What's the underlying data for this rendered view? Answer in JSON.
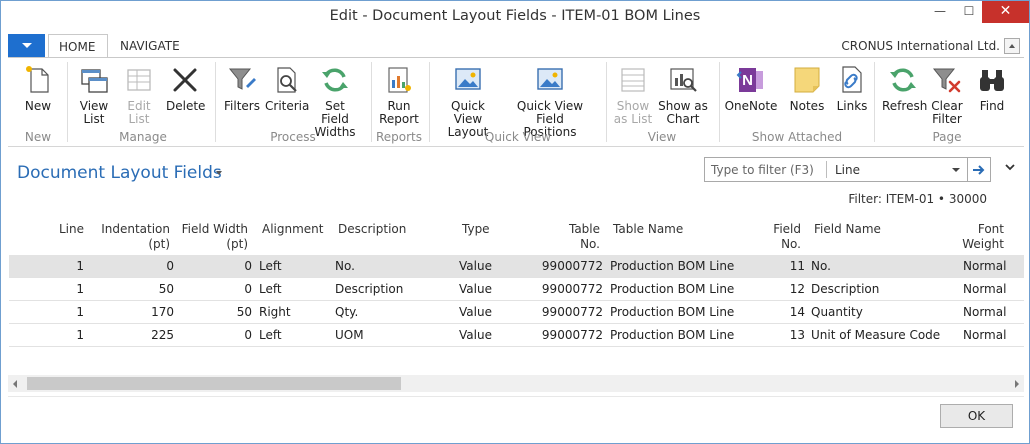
{
  "window": {
    "title": "Edit - Document Layout Fields - ITEM-01 BOM Lines",
    "minimize": "—",
    "maximize": "☐",
    "close": "✕"
  },
  "tabs": [
    {
      "label": "HOME",
      "active": true
    },
    {
      "label": "NAVIGATE",
      "active": false
    }
  ],
  "company": "CRONUS International Ltd.",
  "ribbon": {
    "groups": [
      {
        "label": "New"
      },
      {
        "label": "Manage"
      },
      {
        "label": "Process"
      },
      {
        "label": "Reports"
      },
      {
        "label": "Quick View"
      },
      {
        "label": "View"
      },
      {
        "label": "Show Attached"
      },
      {
        "label": "Page"
      }
    ],
    "buttons": {
      "new": {
        "l1": "New",
        "l2": "",
        "icon": "new-doc-icon"
      },
      "view_list": {
        "l1": "View",
        "l2": "List",
        "icon": "view-list-icon"
      },
      "edit_list": {
        "l1": "Edit",
        "l2": "List",
        "icon": "edit-list-icon"
      },
      "delete": {
        "l1": "Delete",
        "l2": "",
        "icon": "delete-icon"
      },
      "filters": {
        "l1": "Filters",
        "l2": "",
        "icon": "filter-icon"
      },
      "criteria": {
        "l1": "Criteria",
        "l2": "",
        "icon": "criteria-icon"
      },
      "set_field_widths": {
        "l1": "Set Field",
        "l2": "Widths",
        "icon": "refresh-icon"
      },
      "run_report": {
        "l1": "Run",
        "l2": "Report",
        "icon": "report-icon"
      },
      "qv_layout": {
        "l1": "Quick View",
        "l2": "Layout",
        "icon": "picture-icon"
      },
      "qv_field_positions": {
        "l1": "Quick View Field",
        "l2": "Positions",
        "icon": "picture-icon"
      },
      "show_as_list": {
        "l1": "Show",
        "l2": "as List",
        "icon": "list-icon"
      },
      "show_as_chart": {
        "l1": "Show as",
        "l2": "Chart",
        "icon": "chart-icon"
      },
      "onenote": {
        "l1": "OneNote",
        "l2": "",
        "icon": "onenote-icon"
      },
      "notes": {
        "l1": "Notes",
        "l2": "",
        "icon": "note-icon"
      },
      "links": {
        "l1": "Links",
        "l2": "",
        "icon": "link-icon"
      },
      "refresh": {
        "l1": "Refresh",
        "l2": "",
        "icon": "refresh-icon"
      },
      "clear_filter": {
        "l1": "Clear",
        "l2": "Filter",
        "icon": "clear-filter-icon"
      },
      "find": {
        "l1": "Find",
        "l2": "",
        "icon": "binoculars-icon"
      }
    }
  },
  "page": {
    "title": "Document Layout Fields",
    "filter_placeholder": "Type to filter (F3)",
    "filter_field": "Line",
    "filter_text": "Filter: ITEM-01 • 30000"
  },
  "grid": {
    "headers": {
      "line": [
        "Line",
        ""
      ],
      "indentation": [
        "Indentation",
        "(pt)"
      ],
      "field_width": [
        "Field Width",
        "(pt)"
      ],
      "alignment": [
        "Alignment",
        ""
      ],
      "description": [
        "Description",
        ""
      ],
      "type": [
        "Type",
        ""
      ],
      "table_no": [
        "Table",
        "No."
      ],
      "table_name": [
        "Table Name",
        ""
      ],
      "field_no": [
        "Field",
        "No."
      ],
      "field_name": [
        "Field Name",
        ""
      ],
      "font_weight": [
        "Font",
        "Weight"
      ]
    },
    "rows": [
      {
        "line": "1",
        "indentation": "0",
        "field_width": "0",
        "alignment": "Left",
        "description": "No.",
        "type": "Value",
        "table_no": "99000772",
        "table_name": "Production BOM Line",
        "field_no": "11",
        "field_name": "No.",
        "font_weight": "Normal"
      },
      {
        "line": "1",
        "indentation": "50",
        "field_width": "0",
        "alignment": "Left",
        "description": "Description",
        "type": "Value",
        "table_no": "99000772",
        "table_name": "Production BOM Line",
        "field_no": "12",
        "field_name": "Description",
        "font_weight": "Normal"
      },
      {
        "line": "1",
        "indentation": "170",
        "field_width": "50",
        "alignment": "Right",
        "description": "Qty.",
        "type": "Value",
        "table_no": "99000772",
        "table_name": "Production BOM Line",
        "field_no": "14",
        "field_name": "Quantity",
        "font_weight": "Normal"
      },
      {
        "line": "1",
        "indentation": "225",
        "field_width": "0",
        "alignment": "Left",
        "description": "UOM",
        "type": "Value",
        "table_no": "99000772",
        "table_name": "Production BOM Line",
        "field_no": "13",
        "field_name": "Unit of Measure Code",
        "font_weight": "Normal"
      }
    ]
  },
  "ok_label": "OK"
}
